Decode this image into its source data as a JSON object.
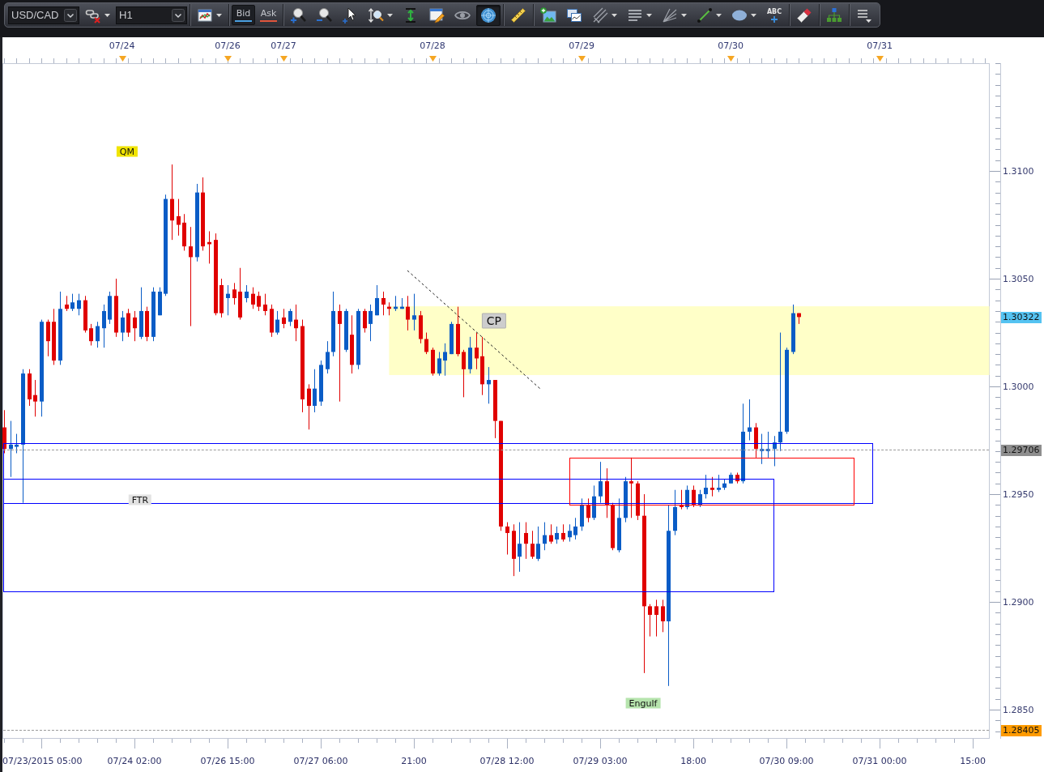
{
  "toolbar": {
    "groups": [
      [
        {
          "kind": "select",
          "value": "USD/CAD"
        },
        {
          "kind": "unlink",
          "dropdown": true,
          "selected": false
        },
        {
          "kind": "select",
          "value": "H1"
        }
      ],
      [
        {
          "kind": "chart_type",
          "dropdown": true,
          "selected": false
        }
      ],
      [
        {
          "kind": "quote",
          "label": "Bid",
          "selected": true,
          "color": "#4a9fe0"
        },
        {
          "kind": "quote",
          "label": "Ask",
          "selected": false,
          "color": "#e0553c"
        }
      ],
      [
        {
          "kind": "zoom_in",
          "dropdown": false,
          "selected": false
        },
        {
          "kind": "zoom_out",
          "dropdown": false,
          "selected": false
        },
        {
          "kind": "pointer",
          "dropdown": false,
          "selected": false
        },
        {
          "kind": "zoom_range",
          "dropdown": true,
          "selected": false
        },
        {
          "kind": "measure",
          "dropdown": false,
          "selected": false
        },
        {
          "kind": "properties",
          "dropdown": false,
          "selected": false
        },
        {
          "kind": "visibility",
          "dropdown": false,
          "selected": false
        },
        {
          "kind": "radar",
          "dropdown": false,
          "selected": true
        }
      ],
      [
        {
          "kind": "ruler",
          "dropdown": false,
          "selected": false
        }
      ],
      [
        {
          "kind": "add_image",
          "dropdown": false,
          "selected": false
        },
        {
          "kind": "overlay",
          "dropdown": false,
          "selected": false
        },
        {
          "kind": "pitchfork",
          "dropdown": true,
          "selected": false
        },
        {
          "kind": "lines",
          "dropdown": true,
          "selected": false
        },
        {
          "kind": "fan",
          "dropdown": true,
          "selected": false
        },
        {
          "kind": "line",
          "dropdown": true,
          "selected": false
        },
        {
          "kind": "ellipse",
          "dropdown": true,
          "selected": false
        },
        {
          "kind": "text_tool",
          "label": "ABC",
          "dropdown": false,
          "selected": false
        }
      ],
      [
        {
          "kind": "eraser",
          "dropdown": false,
          "selected": false
        }
      ],
      [
        {
          "kind": "hierarchy",
          "dropdown": false,
          "selected": false
        }
      ],
      [
        {
          "kind": "menu",
          "dropdown": false,
          "selected": false
        }
      ]
    ]
  },
  "chart": {
    "date_axis": {
      "labels": [
        "07/24",
        "07/26",
        "07/27",
        "07/28",
        "07/29",
        "07/30",
        "07/31"
      ]
    },
    "annotations": [
      {
        "kind": "label",
        "text": "QM",
        "color": "#f0e400"
      },
      {
        "kind": "callout",
        "text": "CP",
        "color": "#cdcdcd"
      },
      {
        "kind": "label",
        "text": "FTR",
        "color": "#e2e2e2"
      },
      {
        "kind": "label",
        "text": "Engulf",
        "color": "#b6e4ad"
      }
    ],
    "price_axis": {
      "labels": [
        "1.3100",
        "1.3050",
        "1.3000",
        "1.2950",
        "1.2900",
        "1.2850"
      ],
      "tags": [
        {
          "label": "1.30322",
          "color": "#55c3f2",
          "line": false
        },
        {
          "label": "1.29706",
          "color": "#8e8e8e",
          "line": true
        },
        {
          "label": "1.28405",
          "color": "#ff9b00",
          "line": true
        }
      ]
    },
    "time_axis": {
      "labels": [
        "07/23/2015 05:00",
        "07/24 02:00",
        "07/26 15:00",
        "07/27 06:00",
        "21:00",
        "07/28 12:00",
        "07/29 03:00",
        "18:00",
        "07/30 09:00",
        "07/31 00:00",
        "15:00"
      ]
    }
  }
}
